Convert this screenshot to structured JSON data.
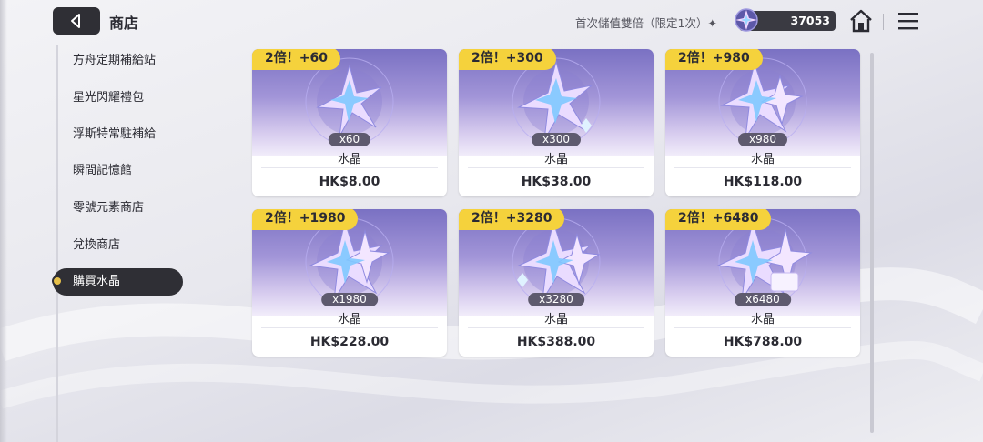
{
  "header": {
    "title": "商店",
    "promo": "首次儲值雙倍（限定1次）✦",
    "crystal_balance": "37053"
  },
  "sidebar": {
    "items": [
      {
        "label": "方舟定期補給站"
      },
      {
        "label": "星光閃耀禮包"
      },
      {
        "label": "浮斯特常駐補給"
      },
      {
        "label": "瞬間記憶館"
      },
      {
        "label": "零號元素商店"
      },
      {
        "label": "兌換商店"
      },
      {
        "label": "購買水晶"
      }
    ],
    "active_index": 6
  },
  "products": [
    {
      "badge": "2倍！+60",
      "qty": "x60",
      "name": "水晶",
      "price": "HK$8.00"
    },
    {
      "badge": "2倍！+300",
      "qty": "x300",
      "name": "水晶",
      "price": "HK$38.00"
    },
    {
      "badge": "2倍！+980",
      "qty": "x980",
      "name": "水晶",
      "price": "HK$118.00"
    },
    {
      "badge": "2倍！+1980",
      "qty": "x1980",
      "name": "水晶",
      "price": "HK$228.00"
    },
    {
      "badge": "2倍！+3280",
      "qty": "x3280",
      "name": "水晶",
      "price": "HK$388.00"
    },
    {
      "badge": "2倍！+6480",
      "qty": "x6480",
      "name": "水晶",
      "price": "HK$788.00"
    }
  ],
  "icons": {
    "back": "back-arrow-icon",
    "currency": "crystal-icon",
    "home": "home-icon",
    "menu": "menu-icon"
  },
  "colors": {
    "accent_badge": "#f5d23c",
    "dark_ui": "#2f2f35",
    "card_art_top": "#7a71c3"
  }
}
